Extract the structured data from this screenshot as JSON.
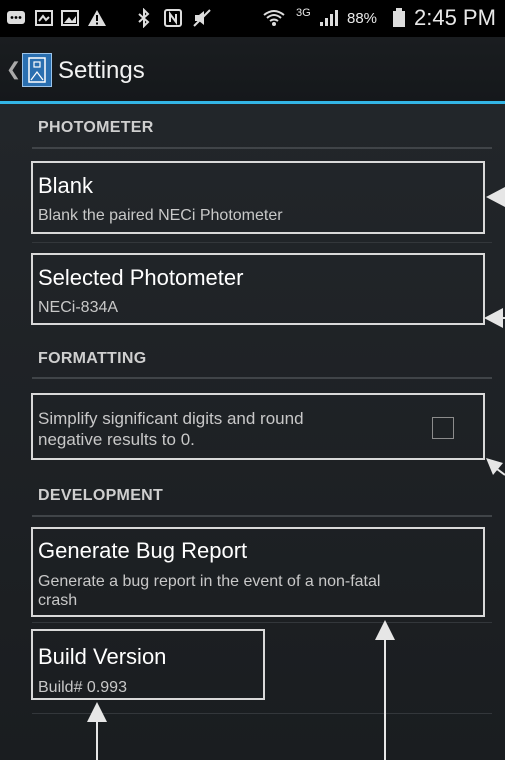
{
  "status_bar": {
    "network": "3G",
    "battery": "88%",
    "time": "2:45 PM",
    "icons": [
      "messaging-icon",
      "gallery-icon",
      "image-icon",
      "warning-icon",
      "bluetooth-icon",
      "nfc-icon",
      "mute-icon",
      "wifi-icon",
      "signal-icon",
      "battery-icon"
    ]
  },
  "action_bar": {
    "title": "Settings",
    "back_glyph": "❮"
  },
  "sections": {
    "photometer": "PHOTOMETER",
    "formatting": "FORMATTING",
    "development": "DEVELOPMENT"
  },
  "items": {
    "blank": {
      "title": "Blank",
      "summary": "Blank the paired NECi Photometer"
    },
    "selected_photometer": {
      "title": "Selected Photometer",
      "summary": "NECi-834A"
    },
    "simplify": {
      "summary_line1": "Simplify significant digits and round",
      "summary_line2": "negative results to 0.",
      "checked": false
    },
    "bug_report": {
      "title": "Generate Bug Report",
      "summary_line1": "Generate a bug report in the event of a non-fatal",
      "summary_line2": "crash"
    },
    "build_version": {
      "title": "Build Version",
      "summary": "Build# 0.993"
    }
  },
  "colors": {
    "accent": "#33b5e5",
    "background": "#1c1f23",
    "highlight_border": "#d9d9d9"
  }
}
